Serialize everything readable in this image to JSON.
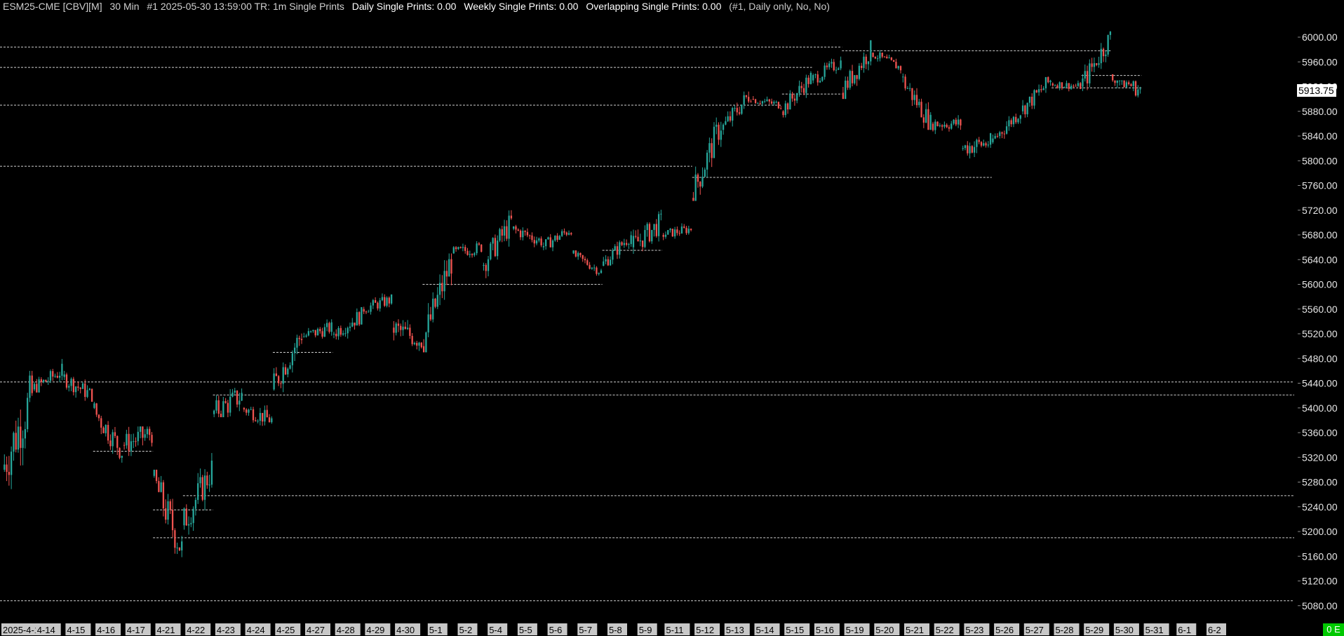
{
  "header": {
    "symbol": "ESM25-CME [CBV][M]",
    "timeframe": "30 Min",
    "info": "#1 2025-05-30 13:59:00 TR: 1m Single Prints",
    "daily_label": "Daily Single Prints: 0.00",
    "weekly_label": "Weekly Single Prints: 0.00",
    "overlap_label": "Overlapping Single Prints: 0.00",
    "params": "(#1, Daily only, No, No)"
  },
  "badge": "0 E",
  "colors": {
    "up": "#26a69a",
    "down": "#ef5350",
    "background": "#000000",
    "text": "#e6e6e6",
    "date_label_bg": "#c8c8c8",
    "badge": "#00c800"
  },
  "chart_data": {
    "type": "candlestick",
    "title": "",
    "y_ticks": [
      6000,
      5960,
      5920,
      5880,
      5840,
      5800,
      5760,
      5720,
      5680,
      5640,
      5600,
      5560,
      5520,
      5480,
      5440,
      5400,
      5360,
      5320,
      5280,
      5240,
      5200,
      5160,
      5120,
      5080
    ],
    "y_tick_labels": [
      "6000.00",
      "5960.00",
      "5920.00",
      "5880.00",
      "5840.00",
      "5800.00",
      "5760.00",
      "5720.00",
      "5680.00",
      "5640.00",
      "5600.00",
      "5560.00",
      "5520.00",
      "5480.00",
      "5440.00",
      "5400.00",
      "5360.00",
      "5320.00",
      "5280.00",
      "5240.00",
      "5200.00",
      "5160.00",
      "5120.00",
      "5080.00"
    ],
    "ylim": [
      5066,
      6056
    ],
    "current_price": "5913.75",
    "x_labels": [
      "2025-4-10",
      "4-14",
      "4-15",
      "4-16",
      "4-17",
      "4-21",
      "4-22",
      "4-23",
      "4-24",
      "4-25",
      "4-27",
      "4-28",
      "4-29",
      "4-30",
      "5-1",
      "5-2",
      "5-4",
      "5-5",
      "5-6",
      "5-7",
      "5-8",
      "5-9",
      "5-11",
      "5-12",
      "5-13",
      "5-14",
      "5-15",
      "5-16",
      "5-19",
      "5-20",
      "5-21",
      "5-22",
      "5-23",
      "5-26",
      "5-27",
      "5-28",
      "5-29",
      "5-30",
      "5-31",
      "6-1",
      "6-2"
    ],
    "sessions": [
      {
        "label": "4-10",
        "o": 5300,
        "c": 5420,
        "h": 5460,
        "l": 5215,
        "end": 5440
      },
      {
        "label": "4-14",
        "o": 5430,
        "c": 5460,
        "h": 5495,
        "l": 5425,
        "end": 5460
      },
      {
        "label": "4-15",
        "o": 5450,
        "c": 5420,
        "h": 5485,
        "l": 5410,
        "end": 5420
      },
      {
        "label": "4-16",
        "o": 5400,
        "c": 5330,
        "h": 5410,
        "l": 5300,
        "end": 5340
      },
      {
        "label": "4-17",
        "o": 5340,
        "c": 5360,
        "h": 5370,
        "l": 5265,
        "end": 5340
      },
      {
        "label": "4-21",
        "o": 5290,
        "c": 5170,
        "h": 5300,
        "l": 5135,
        "end": 5210
      },
      {
        "label": "4-22",
        "o": 5210,
        "c": 5300,
        "h": 5340,
        "l": 5195,
        "end": 5300
      },
      {
        "label": "4-23",
        "o": 5390,
        "c": 5420,
        "h": 5495,
        "l": 5385,
        "end": 5410
      },
      {
        "label": "4-24",
        "o": 5400,
        "c": 5380,
        "h": 5430,
        "l": 5360,
        "end": 5410
      },
      {
        "label": "4-25",
        "o": 5430,
        "c": 5520,
        "h": 5545,
        "l": 5425,
        "end": 5530
      },
      {
        "label": "4-27",
        "o": 5515,
        "c": 5530,
        "h": 5560,
        "l": 5500,
        "end": 5530
      },
      {
        "label": "4-28",
        "o": 5520,
        "c": 5550,
        "h": 5575,
        "l": 5500,
        "end": 5540
      },
      {
        "label": "4-29",
        "o": 5560,
        "c": 5575,
        "h": 5595,
        "l": 5540,
        "end": 5570
      },
      {
        "label": "4-30",
        "o": 5530,
        "c": 5510,
        "h": 5570,
        "l": 5465,
        "end": 5490
      },
      {
        "label": "5-1",
        "o": 5500,
        "c": 5640,
        "h": 5650,
        "l": 5490,
        "end": 5650
      },
      {
        "label": "5-2",
        "o": 5650,
        "c": 5660,
        "h": 5675,
        "l": 5620,
        "end": 5660
      },
      {
        "label": "5-4",
        "o": 5630,
        "c": 5700,
        "h": 5720,
        "l": 5610,
        "end": 5710
      },
      {
        "label": "5-5",
        "o": 5690,
        "c": 5670,
        "h": 5720,
        "l": 5660,
        "end": 5670
      },
      {
        "label": "5-6",
        "o": 5660,
        "c": 5690,
        "h": 5705,
        "l": 5650,
        "end": 5680
      },
      {
        "label": "5-7",
        "o": 5650,
        "c": 5620,
        "h": 5655,
        "l": 5610,
        "end": 5630
      },
      {
        "label": "5-8",
        "o": 5630,
        "c": 5680,
        "h": 5690,
        "l": 5625,
        "end": 5660
      },
      {
        "label": "5-9",
        "o": 5660,
        "c": 5700,
        "h": 5740,
        "l": 5640,
        "end": 5690
      },
      {
        "label": "5-11",
        "o": 5680,
        "c": 5690,
        "h": 5715,
        "l": 5670,
        "end": 5685
      },
      {
        "label": "5-12",
        "o": 5740,
        "c": 5860,
        "h": 5870,
        "l": 5735,
        "end": 5860
      },
      {
        "label": "5-13",
        "o": 5850,
        "c": 5910,
        "h": 5925,
        "l": 5840,
        "end": 5905
      },
      {
        "label": "5-14",
        "o": 5900,
        "c": 5890,
        "h": 5920,
        "l": 5880,
        "end": 5890
      },
      {
        "label": "5-15",
        "o": 5880,
        "c": 5935,
        "h": 5945,
        "l": 5870,
        "end": 5930
      },
      {
        "label": "5-16",
        "o": 5930,
        "c": 5960,
        "h": 5980,
        "l": 5920,
        "end": 5950
      },
      {
        "label": "5-19",
        "o": 5910,
        "c": 5980,
        "h": 5995,
        "l": 5900,
        "end": 5980
      },
      {
        "label": "5-20",
        "o": 5975,
        "c": 5950,
        "h": 5985,
        "l": 5940,
        "end": 5950
      },
      {
        "label": "5-21",
        "o": 5935,
        "c": 5860,
        "h": 5945,
        "l": 5850,
        "end": 5860
      },
      {
        "label": "5-22",
        "o": 5860,
        "c": 5860,
        "h": 5885,
        "l": 5825,
        "end": 5855
      },
      {
        "label": "5-23",
        "o": 5820,
        "c": 5830,
        "h": 5845,
        "l": 5760,
        "end": 5815
      },
      {
        "label": "5-26",
        "o": 5830,
        "c": 5880,
        "h": 5890,
        "l": 5820,
        "end": 5880
      },
      {
        "label": "5-27",
        "o": 5880,
        "c": 5930,
        "h": 5940,
        "l": 5865,
        "end": 5930
      },
      {
        "label": "5-28",
        "o": 5925,
        "c": 5920,
        "h": 5940,
        "l": 5905,
        "end": 5920
      },
      {
        "label": "5-29",
        "o": 5920,
        "c": 6000,
        "h": 6010,
        "l": 5910,
        "end": 5960
      },
      {
        "label": "5-30",
        "o": 5940,
        "c": 5914,
        "h": 5930,
        "l": 5855,
        "end": 5914
      }
    ],
    "single_print_lines": [
      {
        "price": 5984,
        "from": "4-10",
        "to": "5-16"
      },
      {
        "price": 5951,
        "from": "4-10",
        "to": "5-15"
      },
      {
        "price": 5890,
        "from": "4-10",
        "to": "5-14"
      },
      {
        "price": 5791,
        "from": "4-10",
        "to": "5-11"
      },
      {
        "price": 5442,
        "from": "4-10",
        "to": "6-2"
      },
      {
        "price": 5421,
        "from": "4-23",
        "to": "6-2"
      },
      {
        "price": 5258,
        "from": "4-22",
        "to": "6-2"
      },
      {
        "price": 5190,
        "from": "4-21",
        "to": "6-2"
      },
      {
        "price": 5088,
        "from": "4-10",
        "to": "6-2"
      },
      {
        "price": 5978,
        "from": "5-19",
        "to": "5-29"
      },
      {
        "price": 5773,
        "from": "5-12",
        "to": "5-23"
      },
      {
        "price": 5938,
        "from": "5-29",
        "to": "5-30"
      },
      {
        "price": 5918,
        "from": "5-28",
        "to": "5-30"
      },
      {
        "price": 5908,
        "from": "5-15",
        "to": "5-16"
      },
      {
        "price": 5600,
        "from": "5-1",
        "to": "5-7"
      },
      {
        "price": 5655,
        "from": "5-8",
        "to": "5-9"
      },
      {
        "price": 5490,
        "from": "4-25",
        "to": "4-27"
      },
      {
        "price": 5330,
        "from": "4-16",
        "to": "4-17"
      },
      {
        "price": 5235,
        "from": "4-21",
        "to": "4-22"
      }
    ]
  }
}
